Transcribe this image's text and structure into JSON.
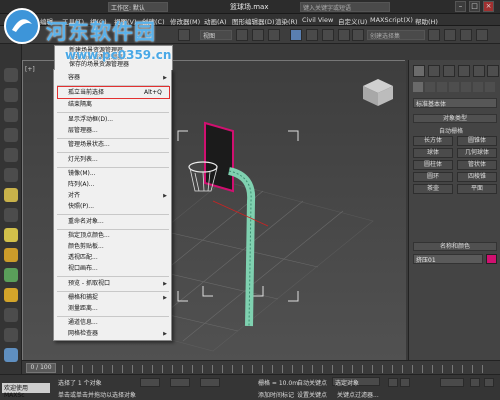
{
  "window": {
    "title": "篮球场.max",
    "workspace": "工作区: 默认",
    "search_placeholder": "键入关键字或短语"
  },
  "menubar": {
    "items": [
      "编辑",
      "工具(T)",
      "组(G)",
      "视图(V)",
      "创建(C)",
      "修改器(M)",
      "动画(A)",
      "图形编辑器(D)",
      "渲染(R)",
      "Civil View",
      "自定义(U)",
      "MAXScript(X)",
      "帮助(H)"
    ]
  },
  "toolbar": {
    "view_dropdown": "视图",
    "selection_set_placeholder": "创建选择集"
  },
  "viewport": {
    "label": "[+]"
  },
  "context_menu": {
    "top_items": [
      "新建场景资源管理器...",
      "管理场景资源管理器...",
      "保存的场景资源管理器"
    ],
    "items": [
      {
        "label": "容器",
        "arrow": true
      },
      {
        "label": "孤立当前选择",
        "shortcut": "Alt+Q",
        "highlighted": true
      },
      {
        "label": "结束隔离"
      },
      {
        "label": "显示浮动框(D)..."
      },
      {
        "label": "层管理器..."
      },
      {
        "label": "管理场景状态..."
      },
      {
        "label": "灯光列表..."
      },
      {
        "label": "镜像(M)..."
      },
      {
        "label": "阵列(A)..."
      },
      {
        "label": "对齐",
        "arrow": true
      },
      {
        "label": "快照(P)..."
      },
      {
        "label": "重命名对象..."
      },
      {
        "label": "指定顶点颜色..."
      },
      {
        "label": "颜色剪贴板..."
      },
      {
        "label": "透视匹配..."
      },
      {
        "label": "视口画布..."
      },
      {
        "label": "预览 - 抓取视口",
        "arrow": true
      },
      {
        "label": "栅格和捕捉",
        "arrow": true
      },
      {
        "label": "测量距离..."
      },
      {
        "label": "通道信息..."
      },
      {
        "label": "网格检查器",
        "arrow": true
      }
    ]
  },
  "command_panel": {
    "dropdown": "标准基本体",
    "object_type_title": "对象类型",
    "auto_grid": "自动栅格",
    "buttons": [
      "长方体",
      "圆锥体",
      "球体",
      "几何球体",
      "圆柱体",
      "管状体",
      "圆环",
      "四棱锥",
      "茶壶",
      "平面"
    ],
    "name_color_title": "名称和颜色",
    "object_name": "挤压01",
    "color": "#d01070"
  },
  "timeline": {
    "frame_label": "0 / 100"
  },
  "statusbar": {
    "welcome": "欢迎使用 MAXSc",
    "selected_label": "选择了 1 个对象",
    "hint": "单击或单击并拖动以选择对象",
    "grid": "栅格 = 10.0m",
    "auto_key": "自动关键点",
    "selected_dd": "选定对象",
    "set_key": "设置关键点",
    "key_filter": "关键点过滤器...",
    "add_time_tag": "添加时间标记"
  },
  "watermark": {
    "title": "河东软件园",
    "url": "www.pc0359.cn"
  }
}
